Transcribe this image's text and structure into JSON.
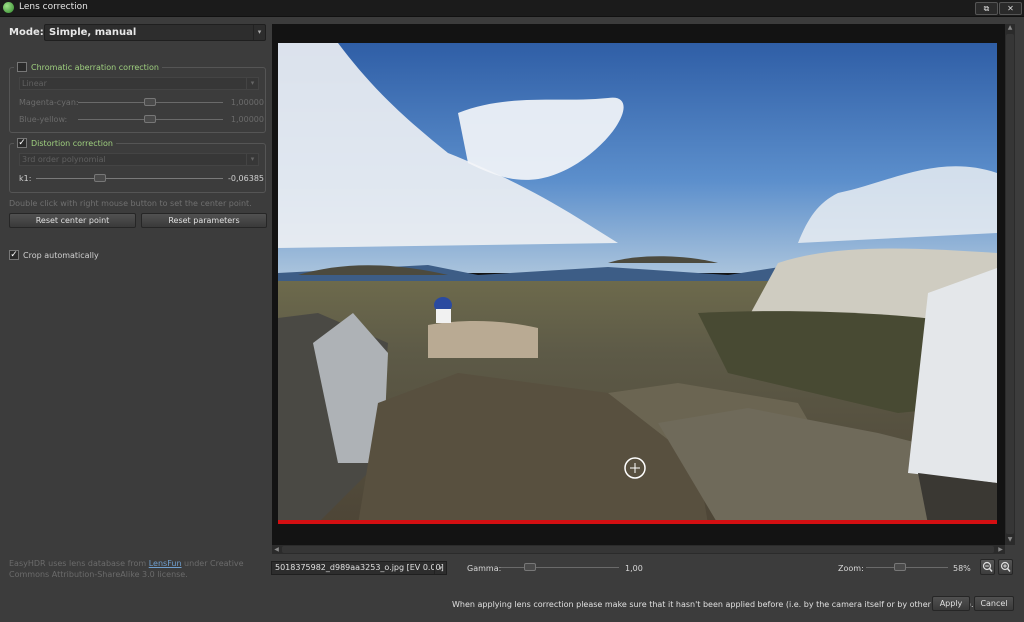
{
  "window": {
    "title": "Lens correction",
    "restore_glyph": "⧉",
    "close_glyph": "✕"
  },
  "mode": {
    "label": "Mode:",
    "value": "Simple, manual"
  },
  "chromatic": {
    "title": "Chromatic aberration correction",
    "checked": false,
    "method": "Linear",
    "sliders": [
      {
        "label": "Magenta-cyan:",
        "value": "1,00000"
      },
      {
        "label": "Blue-yellow:",
        "value": "1,00000"
      }
    ]
  },
  "distortion": {
    "title": "Distortion correction",
    "checked": true,
    "check_glyph": "✓",
    "method": "3rd order polynomial",
    "k1_label": "k1:",
    "k1_value": "-0,06385"
  },
  "hint": "Double click with right mouse button to set the center point.",
  "buttons": {
    "reset_center": "Reset center point",
    "reset_params": "Reset parameters",
    "apply": "Apply",
    "cancel": "Cancel"
  },
  "crop": {
    "label": "Crop automatically",
    "checked": true
  },
  "credit": {
    "prefix": "EasyHDR uses lens database from ",
    "link": "LensFun",
    "suffix": " under Creative Commons Attribution-ShareAlike 3.0 license."
  },
  "file": {
    "value": "5018375982_d989aa3253_o.jpg [EV 0.00]"
  },
  "gamma": {
    "label": "Gamma:",
    "value": "1,00"
  },
  "zoom": {
    "label": "Zoom:",
    "value": "58%"
  },
  "footer_note": "When applying lens correction please make sure that it hasn't been applied before (i.e. by the camera itself or by other software).",
  "icons": {
    "dropdown": "▾",
    "scroll_up": "▲",
    "scroll_down": "▼",
    "scroll_left": "◀",
    "scroll_right": "▶"
  }
}
